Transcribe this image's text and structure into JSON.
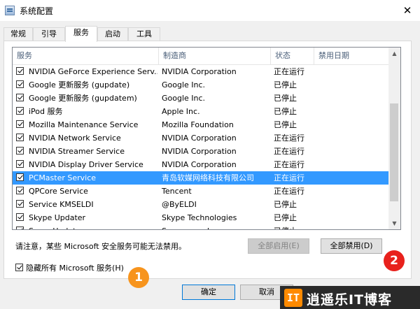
{
  "window": {
    "title": "系统配置",
    "close_glyph": "✕"
  },
  "tabs": [
    {
      "label": "常规"
    },
    {
      "label": "引导"
    },
    {
      "label": "服务"
    },
    {
      "label": "启动"
    },
    {
      "label": "工具"
    }
  ],
  "table": {
    "columns": [
      "服务",
      "制造商",
      "状态",
      "禁用日期"
    ],
    "rows": [
      {
        "service": "NVIDIA GeForce Experience Serv...",
        "maker": "NVIDIA Corporation",
        "status": "正在运行",
        "checked": true
      },
      {
        "service": "Google 更新服务 (gupdate)",
        "maker": "Google Inc.",
        "status": "已停止",
        "checked": true
      },
      {
        "service": "Google 更新服务 (gupdatem)",
        "maker": "Google Inc.",
        "status": "已停止",
        "checked": true
      },
      {
        "service": "iPod 服务",
        "maker": "Apple Inc.",
        "status": "已停止",
        "checked": true
      },
      {
        "service": "Mozilla Maintenance Service",
        "maker": "Mozilla Foundation",
        "status": "已停止",
        "checked": true
      },
      {
        "service": "NVIDIA Network Service",
        "maker": "NVIDIA Corporation",
        "status": "正在运行",
        "checked": true
      },
      {
        "service": "NVIDIA Streamer Service",
        "maker": "NVIDIA Corporation",
        "status": "正在运行",
        "checked": true
      },
      {
        "service": "NVIDIA Display Driver Service",
        "maker": "NVIDIA Corporation",
        "status": "正在运行",
        "checked": true
      },
      {
        "service": "PCMaster Service",
        "maker": "青岛软媒网络科技有限公司",
        "status": "正在运行",
        "checked": true,
        "selected": true
      },
      {
        "service": "QPCore Service",
        "maker": "Tencent",
        "status": "正在运行",
        "checked": true
      },
      {
        "service": "Service KMSELDI",
        "maker": "@ByELDI",
        "status": "已停止",
        "checked": true
      },
      {
        "service": "Skype Updater",
        "maker": "Skype Technologies",
        "status": "已停止",
        "checked": true
      },
      {
        "service": "SogouUpdate",
        "maker": "Sogou.com Inc",
        "status": "已停止",
        "checked": true
      }
    ]
  },
  "note": "请注意，某些 Microsoft 安全服务可能无法禁用。",
  "buttons": {
    "enable_all": "全部启用(E)",
    "disable_all": "全部禁用(D)",
    "ok": "确定",
    "cancel": "取消"
  },
  "hide_ms": {
    "label": "隐藏所有 Microsoft 服务(H)",
    "checked": true
  },
  "callouts": {
    "one": "1",
    "two": "2"
  },
  "watermark": {
    "badge": "IT",
    "text": "逍遥乐IT博客"
  },
  "colors": {
    "selection": "#3399ff",
    "callout_one": "#f7941d",
    "callout_two": "#e8211c"
  }
}
